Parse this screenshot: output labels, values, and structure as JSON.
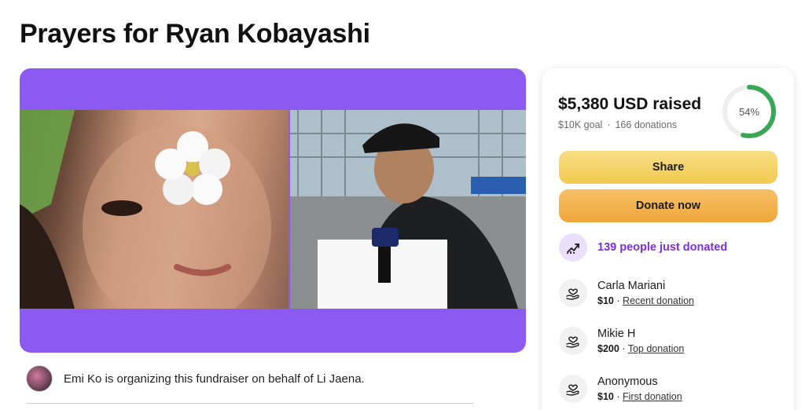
{
  "page": {
    "title": "Prayers for Ryan Kobayashi"
  },
  "organizer": {
    "text": "Emi Ko is organizing this fundraiser on behalf of Li Jaena."
  },
  "donation_card": {
    "raised": "$5,380 USD raised",
    "goal": "$10K goal",
    "separator": "·",
    "donations": "166 donations",
    "progress_label": "54%",
    "progress_fraction": 0.54,
    "share_label": "Share",
    "donate_label": "Donate now",
    "trend_text": "139 people just donated",
    "donors": [
      {
        "name": "Carla Mariani",
        "amount": "$10",
        "sep": " · ",
        "tag": "Recent donation"
      },
      {
        "name": "Mikie H",
        "amount": "$200",
        "sep": " · ",
        "tag": "Top donation"
      },
      {
        "name": "Anonymous",
        "amount": "$10",
        "sep": " · ",
        "tag": "First donation"
      }
    ]
  },
  "colors": {
    "hero_bg": "#8c5af0",
    "progress_green": "#3aa757",
    "accent_purple": "#7a2ee6",
    "share_yellow": "#f2c94f",
    "donate_orange": "#f0a63a"
  },
  "icons": {
    "trend": "trending-up-icon",
    "donor": "heart-hand-icon"
  }
}
